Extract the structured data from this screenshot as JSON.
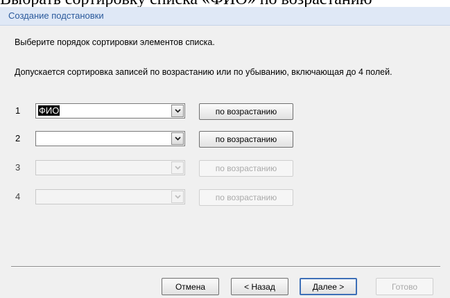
{
  "document": {
    "text_above": "Выбрать сортировку списка «ФИО» по возрастанию"
  },
  "dialog": {
    "title": "Создание подстановки",
    "instruction_1": "Выберите порядок сортировки элементов списка.",
    "instruction_2": "Допускается сортировка записей по возрастанию или по убыванию, включающая до 4 полей.",
    "rows": [
      {
        "number": "1",
        "field_value": "ФИО",
        "sort_label": "по возрастанию",
        "enabled": true
      },
      {
        "number": "2",
        "field_value": "",
        "sort_label": "по возрастанию",
        "enabled": true
      },
      {
        "number": "3",
        "field_value": "",
        "sort_label": "по возрастанию",
        "enabled": false
      },
      {
        "number": "4",
        "field_value": "",
        "sort_label": "по возрастанию",
        "enabled": false
      }
    ],
    "buttons": {
      "cancel": "Отмена",
      "back": "< Назад",
      "next": "Далее >",
      "finish": "Готово"
    }
  },
  "icons": {
    "dropdown": "chevron-down-icon"
  },
  "colors": {
    "title_text": "#2b5a9c",
    "title_bar": "#dfe8f6",
    "dialog_bg": "#f0f0f0",
    "default_button_border": "#3d6fb7",
    "disabled_text": "#aaaaaa"
  }
}
